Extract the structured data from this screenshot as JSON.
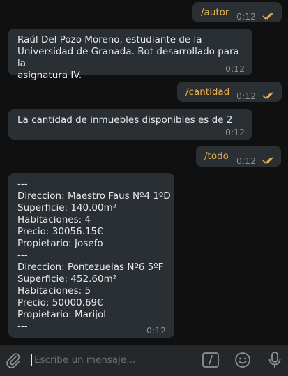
{
  "messages": [
    {
      "type": "out",
      "text": "/autor",
      "time": "0:12"
    },
    {
      "type": "in",
      "text": "Raúl Del Pozo Moreno, estudiante de la\nUniversidad de Granada. Bot desarrollado para la\nasignatura IV.",
      "time": "0:12"
    },
    {
      "type": "out",
      "text": "/cantidad",
      "time": "0:12"
    },
    {
      "type": "in",
      "text": "La cantidad de inmuebles disponibles es de 2",
      "time": "0:12"
    },
    {
      "type": "out",
      "text": "/todo",
      "time": "0:12"
    },
    {
      "type": "in",
      "text": "---\nDireccion: Maestro Faus Nº4 1ºD\nSuperficie: 140.00m²\nHabitaciones: 4\nPrecio: 30056.15€\nPropietario: Josefo\n---\nDireccion: Pontezuelas Nº6 5ºF\nSuperficie: 452.60m²\nHabitaciones: 5\nPrecio: 50000.69€\nPropietario: Marijol\n---",
      "time": "0:12"
    }
  ],
  "composer": {
    "placeholder": "Escribe un mensaje...",
    "icons": [
      "paperclip-icon",
      "slash-command-icon",
      "emoji-icon",
      "microphone-icon"
    ]
  },
  "colors": {
    "background": "#101010",
    "bubble": "#2a2f33",
    "command": "#e8b04a",
    "ticks": "#e8b04a",
    "time": "#8d9196",
    "composer": "#24282b"
  }
}
